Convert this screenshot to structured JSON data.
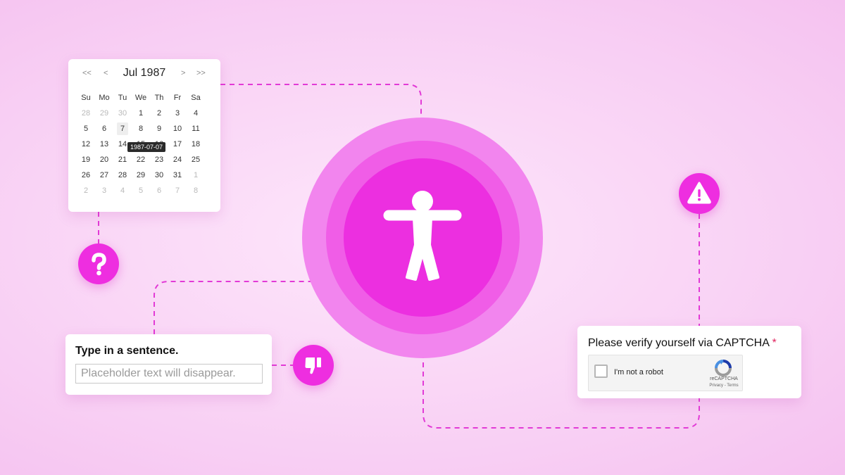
{
  "calendar": {
    "prev_year": "<<",
    "prev_month": "<",
    "title": "Jul 1987",
    "next_month": ">",
    "next_year": ">>",
    "weekdays": [
      "Su",
      "Mo",
      "Tu",
      "We",
      "Th",
      "Fr",
      "Sa"
    ],
    "weeks": [
      [
        {
          "d": "28",
          "dim": true
        },
        {
          "d": "29",
          "dim": true
        },
        {
          "d": "30",
          "dim": true
        },
        {
          "d": "1"
        },
        {
          "d": "2"
        },
        {
          "d": "3"
        },
        {
          "d": "4"
        }
      ],
      [
        {
          "d": "5"
        },
        {
          "d": "6"
        },
        {
          "d": "7",
          "sel": true
        },
        {
          "d": "8"
        },
        {
          "d": "9"
        },
        {
          "d": "10"
        },
        {
          "d": "11"
        }
      ],
      [
        {
          "d": "12"
        },
        {
          "d": "13"
        },
        {
          "d": "14"
        },
        {
          "d": "15"
        },
        {
          "d": "16"
        },
        {
          "d": "17"
        },
        {
          "d": "18"
        }
      ],
      [
        {
          "d": "19"
        },
        {
          "d": "20"
        },
        {
          "d": "21"
        },
        {
          "d": "22"
        },
        {
          "d": "23"
        },
        {
          "d": "24"
        },
        {
          "d": "25"
        }
      ],
      [
        {
          "d": "26"
        },
        {
          "d": "27"
        },
        {
          "d": "28"
        },
        {
          "d": "29"
        },
        {
          "d": "30"
        },
        {
          "d": "31"
        },
        {
          "d": "1",
          "dim": true
        }
      ],
      [
        {
          "d": "2",
          "dim": true
        },
        {
          "d": "3",
          "dim": true
        },
        {
          "d": "4",
          "dim": true
        },
        {
          "d": "5",
          "dim": true
        },
        {
          "d": "6",
          "dim": true
        },
        {
          "d": "7",
          "dim": true
        },
        {
          "d": "8",
          "dim": true
        }
      ]
    ],
    "tooltip": "1987-07-07"
  },
  "sentence": {
    "label": "Type in a sentence.",
    "value": "",
    "placeholder": "Placeholder text will disappear."
  },
  "captcha": {
    "label": "Please verify yourself via CAPTCHA",
    "required_mark": "*",
    "checkbox_label": "I'm not a robot",
    "brand": "reCAPTCHA",
    "terms": "Privacy - Terms"
  },
  "icons": {
    "question": "question-icon",
    "thumbs_down": "thumbs-down-icon",
    "warning": "warning-icon",
    "accessibility": "accessibility-icon"
  },
  "colors": {
    "accent": "#ec2fe0",
    "ring_outer": "#f285ee",
    "ring_middle": "#f05de7",
    "connector": "#e23ad6",
    "background": "#f9d3f5"
  }
}
